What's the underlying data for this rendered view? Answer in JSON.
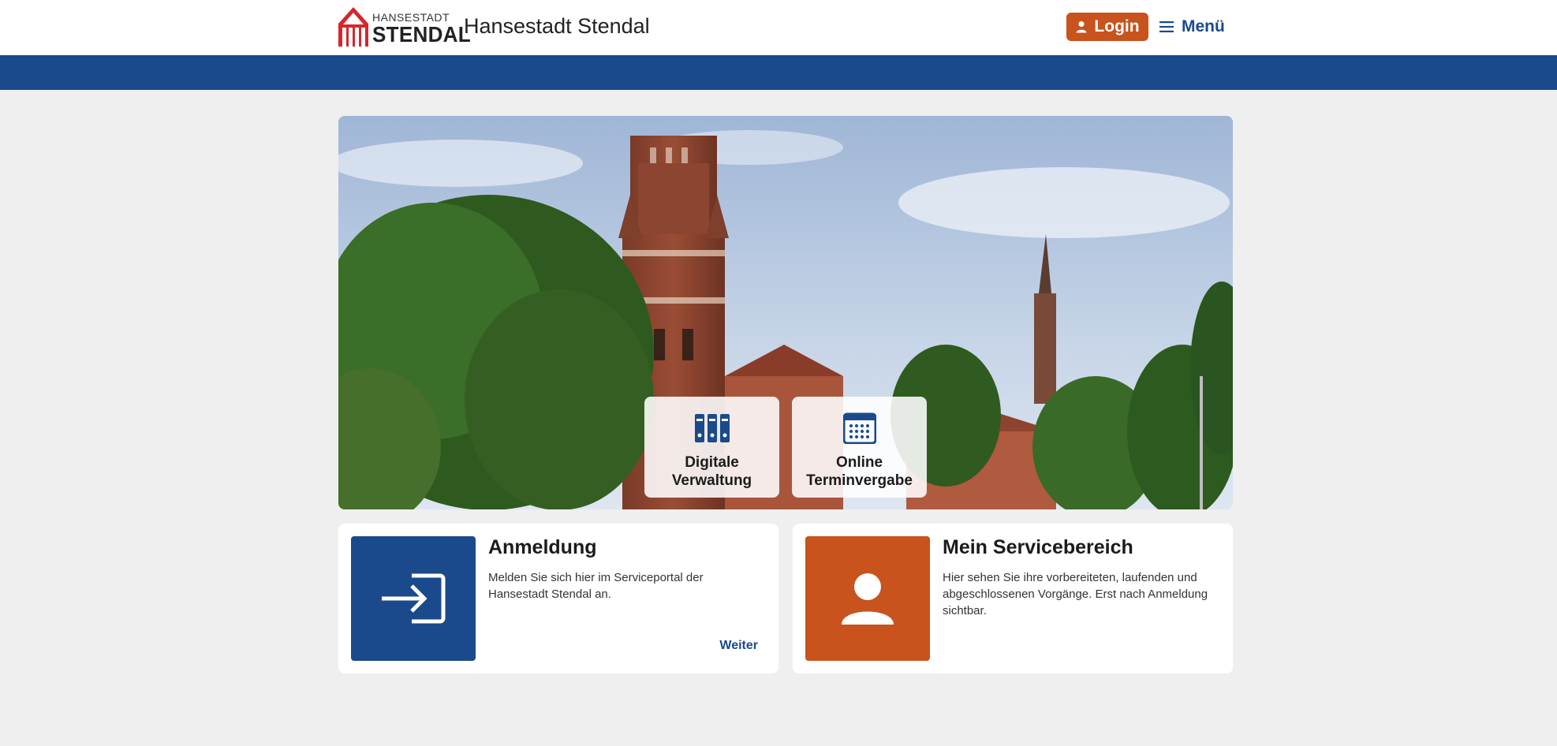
{
  "header": {
    "logo_small": "HANSESTADT",
    "logo_big": "STENDAL",
    "site_title": "Hansestadt Stendal",
    "login_label": "Login",
    "menu_label": "Menü"
  },
  "colors": {
    "brand_blue": "#1a4a8c",
    "accent_orange": "#c8531c",
    "logo_red": "#d7262b",
    "page_background": "#efefef"
  },
  "hero": {
    "quick_links": [
      {
        "line1": "Digitale",
        "line2": "Verwaltung",
        "icon": "binders-icon"
      },
      {
        "line1": "Online",
        "line2": "Terminvergabe",
        "icon": "calendar-icon"
      }
    ]
  },
  "cards": [
    {
      "title": "Anmeldung",
      "description": "Melden Sie sich hier im Serviceportal der Hansestadt Stendal an.",
      "link": "Weiter",
      "icon": "login-icon"
    },
    {
      "title": "Mein Servicebereich",
      "description": "Hier sehen Sie ihre vorbereiteten, laufenden und abgeschlossenen Vorgänge. Erst nach Anmeldung sichtbar.",
      "icon": "user-icon"
    }
  ]
}
